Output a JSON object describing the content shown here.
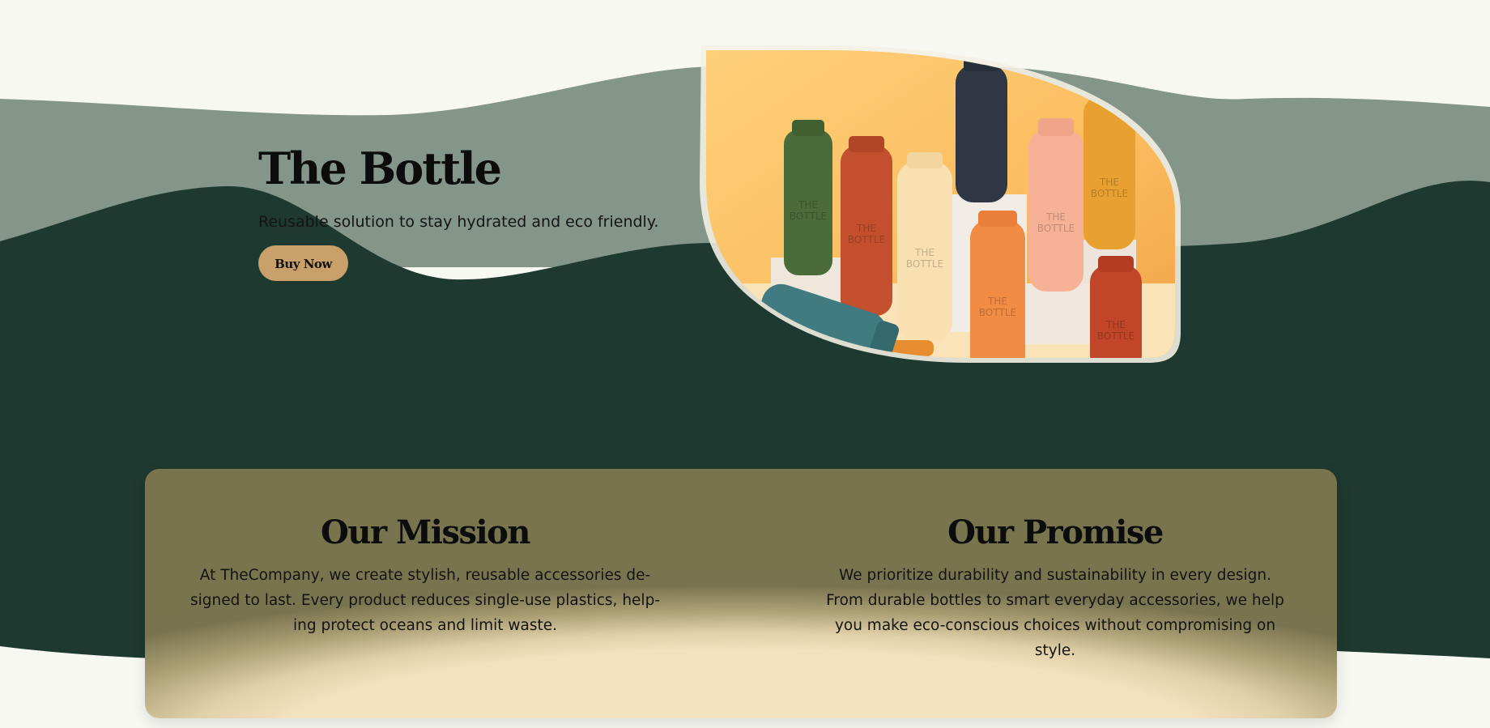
{
  "colors": {
    "page_background": "#f8f8f3",
    "sage_wave": "#84958a",
    "forest_green": "#1e392f",
    "button_tan": "#c9a06a",
    "card_olive": "#78744e",
    "card_cream": "#f4e1bd"
  },
  "hero": {
    "title": "The Bottle",
    "subtitle": "Reusable solution to stay hydrated and eco friendly.",
    "button_label": "Buy Now",
    "image": {
      "subject": "colorful-reusable-bottles-on-pedestals",
      "bottle_label_line1": "THE",
      "bottle_label_line2": "BOTTLE"
    }
  },
  "mission": {
    "title": "Our Mission",
    "lines": [
      "At TheCompany, we create stylish, reusable accessories de-",
      "signed to last. Every product reduces single-use plastics, help-",
      "ing protect oceans and limit waste."
    ]
  },
  "promise": {
    "title": "Our Promise",
    "lines": [
      "We prioritize durability and sustainability in every design.",
      "From durable bottles to smart everyday accessories, we help",
      "you make eco-conscious choices without compromising on",
      "style."
    ]
  }
}
